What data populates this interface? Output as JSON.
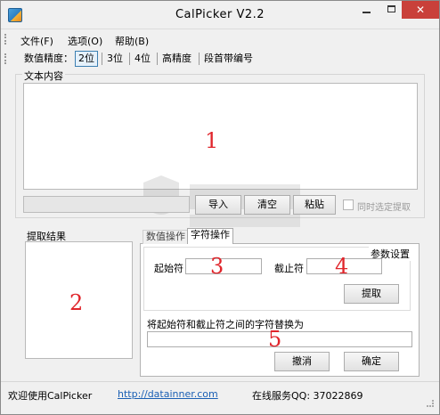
{
  "window": {
    "title": "CalPicker  V2.2",
    "minimize_glyph": "",
    "close_glyph": "✕"
  },
  "menu": [
    "文件(F)",
    "选项(O)",
    "帮助(B)"
  ],
  "toolbar": {
    "precision_label": "数值精度：",
    "items": [
      "2位",
      "3位",
      "4位",
      "高精度",
      "段首带编号"
    ],
    "selected": "2位"
  },
  "text_group": {
    "legend": "文本内容",
    "marker": "1",
    "import_button": "导入",
    "clear_button": "清空",
    "paste_button": "粘贴",
    "sync_checkbox_label": "同时选定提取",
    "sync_checked": false
  },
  "result": {
    "legend": "提取结果",
    "marker": "2"
  },
  "tabs": {
    "items": [
      "数值操作",
      "字符操作"
    ],
    "active": "字符操作"
  },
  "params": {
    "legend": "参数设置",
    "start_label": "起始符",
    "start_value": "",
    "start_marker": "3",
    "end_label": "截止符",
    "end_value": "",
    "end_marker": "4",
    "extract_button": "提取"
  },
  "replace": {
    "label": "将起始符和截止符之间的字符替换为",
    "value": "",
    "marker": "5",
    "cancel_button": "撤消",
    "ok_button": "确定"
  },
  "status": {
    "welcome": "欢迎使用CalPicker",
    "link": "http://datainner.com",
    "service": "在线服务QQ: 37022869"
  },
  "colors": {
    "marker": "#e0252b",
    "close_button": "#c9403a",
    "link": "#1a5fb4"
  }
}
